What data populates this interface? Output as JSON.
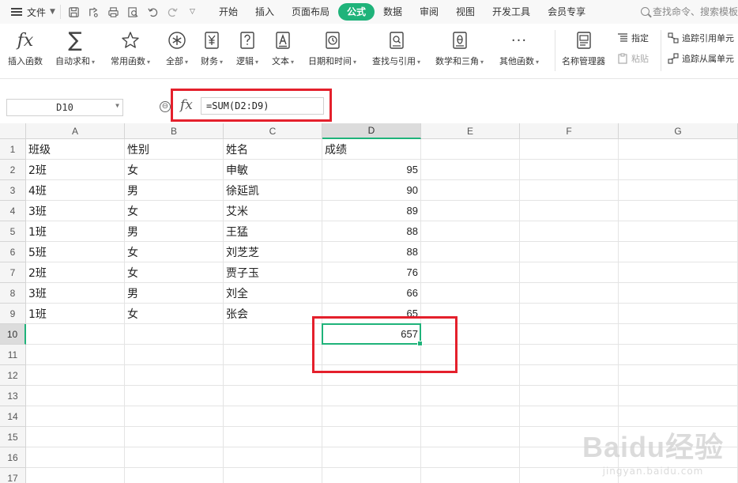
{
  "menubar": {
    "file_label": "文件",
    "tabs": [
      {
        "label": "开始",
        "active": false
      },
      {
        "label": "插入",
        "active": false
      },
      {
        "label": "页面布局",
        "active": false
      },
      {
        "label": "公式",
        "active": true
      },
      {
        "label": "数据",
        "active": false
      },
      {
        "label": "审阅",
        "active": false
      },
      {
        "label": "视图",
        "active": false
      },
      {
        "label": "开发工具",
        "active": false
      },
      {
        "label": "会员专享",
        "active": false
      }
    ],
    "search_placeholder": "查找命令、搜索模板"
  },
  "ribbon": {
    "buttons": [
      {
        "label": "插入函数",
        "icon": "fx-icon",
        "dropdown": false
      },
      {
        "label": "自动求和",
        "icon": "sigma-icon",
        "dropdown": true
      },
      {
        "label": "常用函数",
        "icon": "star-icon",
        "dropdown": true
      },
      {
        "label": "全部",
        "icon": "asterisk-icon",
        "dropdown": true
      },
      {
        "label": "财务",
        "icon": "yen-icon",
        "dropdown": true
      },
      {
        "label": "逻辑",
        "icon": "question-icon",
        "dropdown": true
      },
      {
        "label": "文本",
        "icon": "text-a-icon",
        "dropdown": true
      },
      {
        "label": "日期和时间",
        "icon": "clock-icon",
        "dropdown": true
      },
      {
        "label": "查找与引用",
        "icon": "search-doc-icon",
        "dropdown": true
      },
      {
        "label": "数学和三角",
        "icon": "theta-icon",
        "dropdown": true
      },
      {
        "label": "其他函数",
        "icon": "more-dots-icon",
        "dropdown": true
      },
      {
        "label": "名称管理器",
        "icon": "name-manager-icon",
        "dropdown": false
      }
    ],
    "small": {
      "assign": "指定",
      "paste": "粘贴",
      "trace_precedents": "追踪引用单元",
      "trace_dependents": "追踪从属单元"
    }
  },
  "formula_bar": {
    "name_box": "D10",
    "formula": "=SUM(D2:D9)"
  },
  "sheet": {
    "columns": [
      "A",
      "B",
      "C",
      "D",
      "E",
      "F",
      "G"
    ],
    "selected_column": "D",
    "selected_row": "10",
    "row_numbers": [
      "1",
      "2",
      "3",
      "4",
      "5",
      "6",
      "7",
      "8",
      "9",
      "10",
      "11",
      "12",
      "13",
      "14",
      "15",
      "16",
      "17"
    ],
    "rows": [
      [
        "班级",
        "性别",
        "姓名",
        "成绩"
      ],
      [
        "2班",
        "女",
        "申敏",
        "95"
      ],
      [
        "4班",
        "男",
        "徐延凯",
        "90"
      ],
      [
        "3班",
        "女",
        "艾米",
        "89"
      ],
      [
        "1班",
        "男",
        "王猛",
        "88"
      ],
      [
        "5班",
        "女",
        "刘芝芝",
        "88"
      ],
      [
        "2班",
        "女",
        "贾子玉",
        "76"
      ],
      [
        "3班",
        "男",
        "刘全",
        "66"
      ],
      [
        "1班",
        "女",
        "张会",
        "65"
      ],
      [
        "",
        "",
        "",
        "657"
      ]
    ]
  },
  "watermark": {
    "brand": "Baidu经验",
    "url": "jingyan.baidu.com"
  },
  "colors": {
    "accent": "#1fb37a",
    "highlight_red": "#e4202c"
  }
}
